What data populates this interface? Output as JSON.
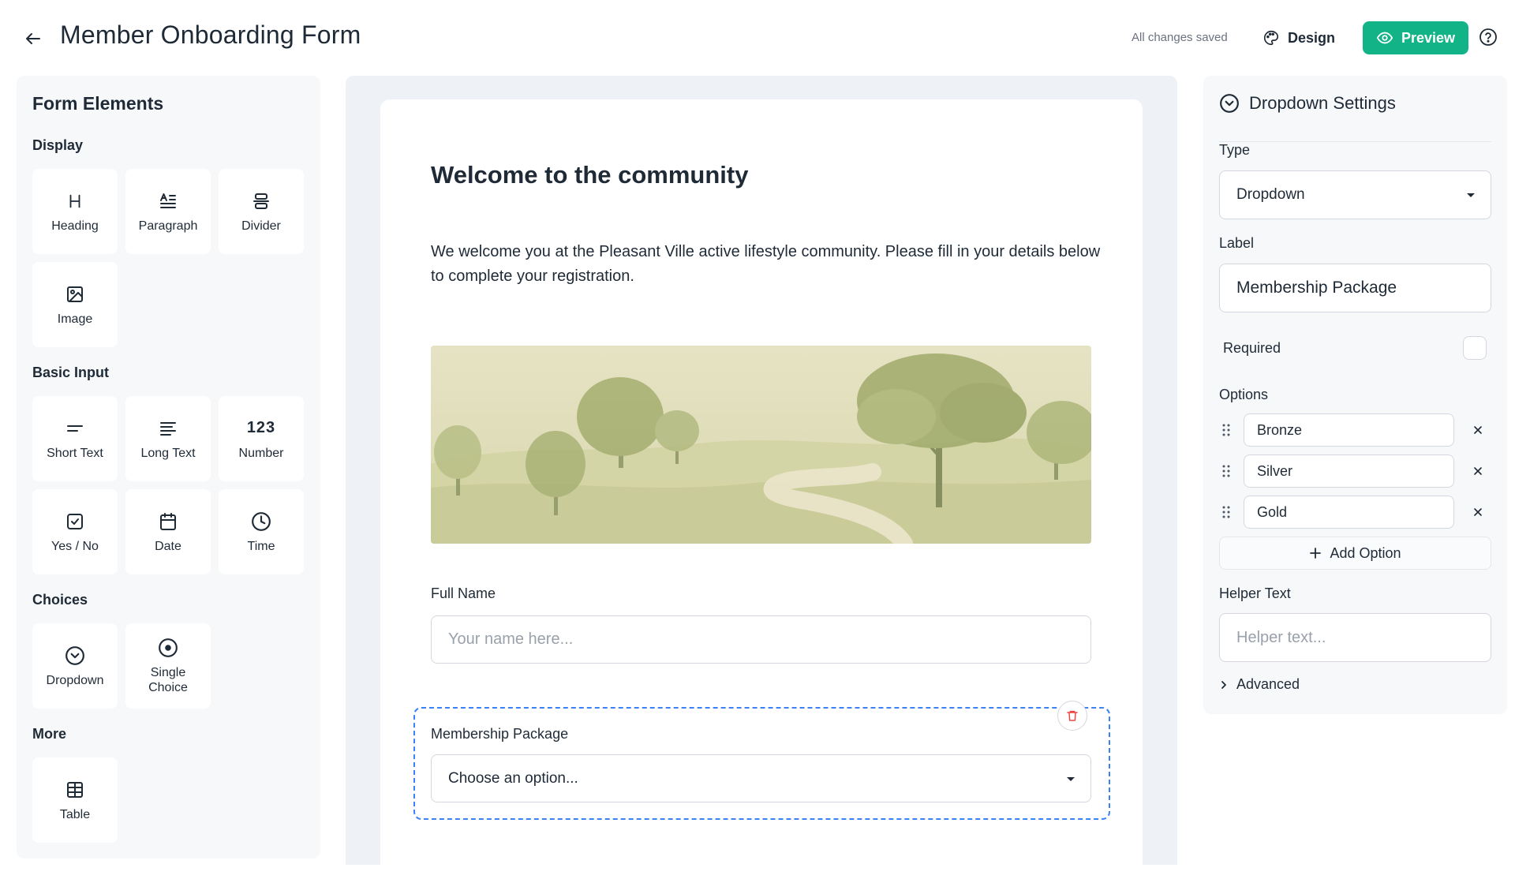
{
  "header": {
    "title": "Member Onboarding Form",
    "save_status": "All changes saved",
    "design_label": "Design",
    "preview_label": "Preview"
  },
  "left_panel": {
    "title": "Form Elements",
    "sections": {
      "display": "Display",
      "basic_input": "Basic Input",
      "choices": "Choices",
      "more": "More"
    },
    "elements": {
      "heading": "Heading",
      "paragraph": "Paragraph",
      "divider": "Divider",
      "image": "Image",
      "short_text": "Short Text",
      "long_text": "Long Text",
      "number": "Number",
      "number_glyph": "123",
      "yes_no": "Yes / No",
      "date": "Date",
      "time": "Time",
      "dropdown": "Dropdown",
      "single_choice": "Single Choice",
      "table": "Table"
    }
  },
  "form": {
    "title": "Welcome to the community",
    "intro": "We welcome you at the Pleasant Ville active lifestyle community. Please fill in your details below to complete your registration.",
    "full_name_label": "Full Name",
    "full_name_placeholder": "Your name here...",
    "membership_label": "Membership Package",
    "membership_placeholder": "Choose an option..."
  },
  "settings": {
    "title": "Dropdown Settings",
    "type_label": "Type",
    "type_value": "Dropdown",
    "label_label": "Label",
    "label_value": "Membership Package",
    "required_label": "Required",
    "required": false,
    "options_label": "Options",
    "options": [
      "Bronze",
      "Silver",
      "Gold"
    ],
    "add_option_label": "Add Option",
    "helper_label": "Helper Text",
    "helper_placeholder": "Helper text...",
    "advanced_label": "Advanced"
  },
  "colors": {
    "accent": "#12b386",
    "selection": "#3b82f6",
    "danger": "#ef4444"
  }
}
